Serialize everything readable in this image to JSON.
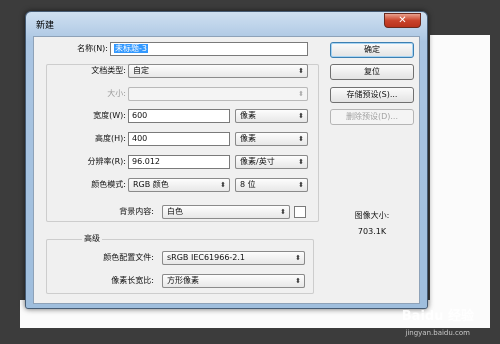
{
  "window": {
    "title": "新建",
    "close": "✕"
  },
  "form": {
    "name_label": "名称(N):",
    "name_value": "未标题-3",
    "preset_label": "文档类型:",
    "preset_value": "自定",
    "size_label": "大小:",
    "size_value": "",
    "width_label": "宽度(W):",
    "width_value": "600",
    "width_unit": "像素",
    "height_label": "高度(H):",
    "height_value": "400",
    "height_unit": "像素",
    "resolution_label": "分辨率(R):",
    "resolution_value": "96.012",
    "resolution_unit": "像素/英寸",
    "color_mode_label": "颜色模式:",
    "color_mode_value": "RGB 颜色",
    "bit_depth": "8 位",
    "background_label": "背景内容:",
    "background_value": "白色",
    "advanced_title": "高级",
    "color_profile_label": "颜色配置文件:",
    "color_profile_value": "sRGB IEC61966-2.1",
    "pixel_aspect_label": "像素长宽比:",
    "pixel_aspect_value": "方形像素"
  },
  "buttons": {
    "ok": "确定",
    "reset": "复位",
    "save_preset": "存储预设(S)...",
    "delete_preset": "删除预设(D)..."
  },
  "image_size": {
    "label": "图像大小:",
    "value": "703.1K"
  },
  "watermark": {
    "brand": "Baidu 经验",
    "url": "jingyan.baidu.com"
  }
}
